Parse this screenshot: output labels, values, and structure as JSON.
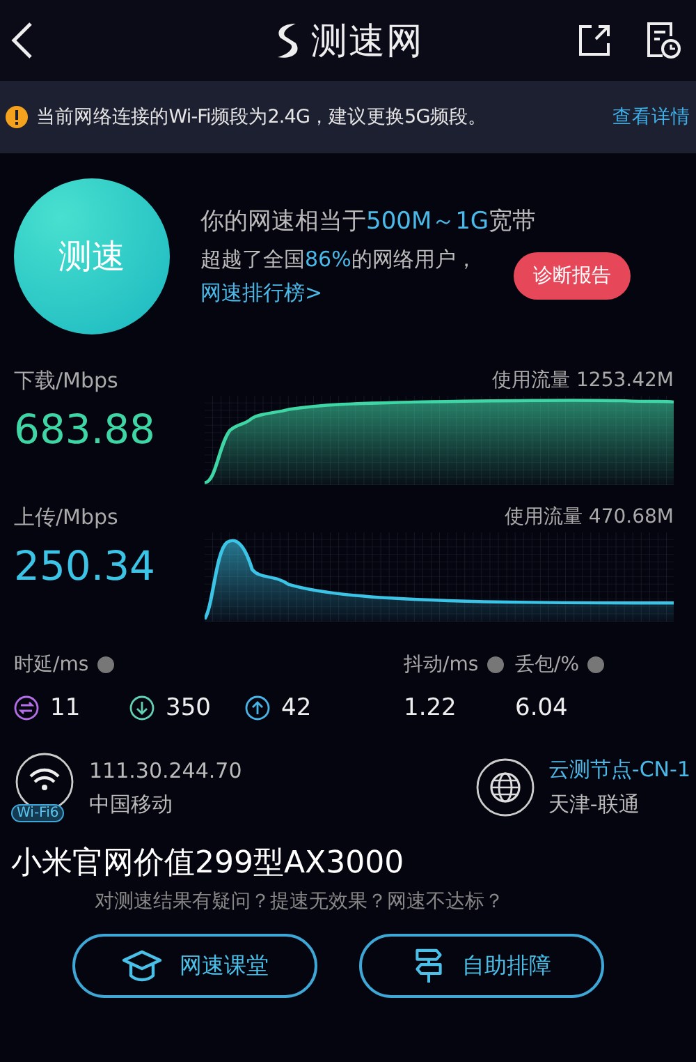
{
  "header": {
    "title": "测速网"
  },
  "notice": {
    "text": "当前网络连接的Wi-Fi频段为2.4G，建议更换5G频段。",
    "link": "查看详情"
  },
  "summary": {
    "button": "测速",
    "headline": "你的网速相当于**500M～1G**宽带",
    "rank_text": "超越了全国**86%**的网络用户，",
    "rank_link": "网速排行榜>",
    "report_button": "诊断报告"
  },
  "speeds": [
    {
      "kind": "download",
      "label": "下载/Mbps",
      "value": "683.88",
      "usage": "使用流量 1253.42M"
    },
    {
      "kind": "upload",
      "label": "上传/Mbps",
      "value": "250.34",
      "usage": "使用流量 470.68M"
    }
  ],
  "latency": {
    "label": "时延/ms",
    "values": [
      {
        "kind": "idle",
        "value": "11"
      },
      {
        "kind": "download",
        "value": "350"
      },
      {
        "kind": "upload",
        "value": "42"
      }
    ]
  },
  "jitter": {
    "label": "抖动/ms",
    "value": "1.22"
  },
  "loss": {
    "label": "丢包/%",
    "value": "6.04"
  },
  "network": {
    "badge": "Wi-Fi6",
    "ip": "111.30.244.70",
    "isp": "中国移动"
  },
  "server": {
    "node": "云测节点-CN-1",
    "location": "天津-联通"
  },
  "plan": {
    "title": "小米官网价值299型AX3000",
    "question": "对测速结果有疑问？提速无效果？网速不达标？"
  },
  "actions": [
    {
      "kind": "course",
      "label": "网速课堂"
    },
    {
      "kind": "diagnose",
      "label": "自助排障"
    }
  ]
}
